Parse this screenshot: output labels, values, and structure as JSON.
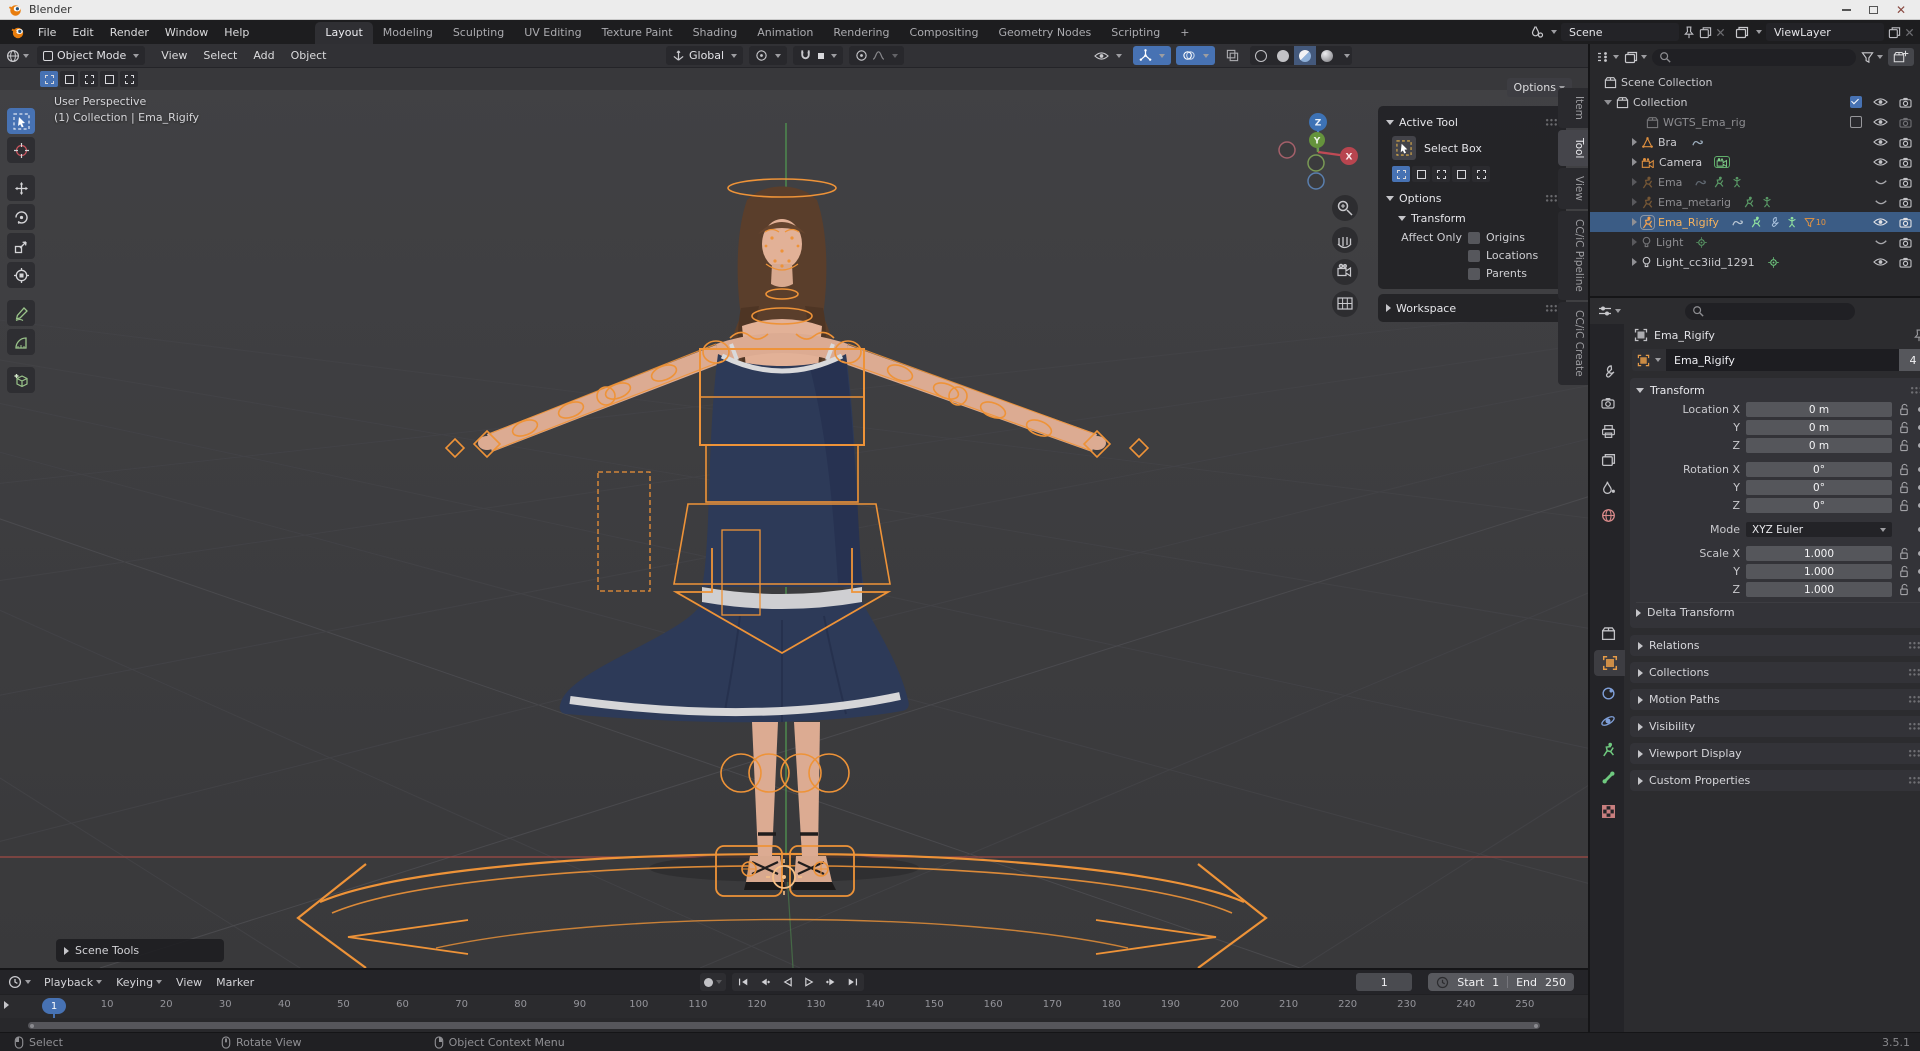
{
  "window": {
    "title": "Blender"
  },
  "topbar": {
    "menus": [
      "File",
      "Edit",
      "Render",
      "Window",
      "Help"
    ],
    "workspaces": [
      "Layout",
      "Modeling",
      "Sculpting",
      "UV Editing",
      "Texture Paint",
      "Shading",
      "Animation",
      "Rendering",
      "Compositing",
      "Geometry Nodes",
      "Scripting"
    ],
    "active_workspace": "Layout",
    "add_tab": "+",
    "scene_label": "Scene",
    "view_layer_label": "ViewLayer"
  },
  "viewport": {
    "header": {
      "mode": "Object Mode",
      "menus": [
        "View",
        "Select",
        "Add",
        "Object"
      ],
      "orientation": "Global"
    },
    "options_button": "Options",
    "overlay_line1": "User Perspective",
    "overlay_line2": "(1) Collection | Ema_Rigify",
    "scene_tools_label": "Scene Tools",
    "axis": {
      "z": "Z",
      "y": "Y",
      "x": "X"
    }
  },
  "tool_panel": {
    "tabs": [
      "Item",
      "Tool",
      "View",
      "CC/iC Pipeline",
      "CC/iC Create"
    ],
    "active_tab": "Tool",
    "active_tool": "Active Tool",
    "tool_name": "Select Box",
    "options": "Options",
    "transform": "Transform",
    "affect_only": "Affect Only",
    "origins": "Origins",
    "locations": "Locations",
    "parents": "Parents",
    "workspace": "Workspace"
  },
  "outliner": {
    "rows": [
      {
        "name": "Scene Collection"
      },
      {
        "name": "Collection"
      },
      {
        "name": "WGTS_Ema_rig"
      },
      {
        "name": "Bra"
      },
      {
        "name": "Camera"
      },
      {
        "name": "Ema"
      },
      {
        "name": "Ema_metarig"
      },
      {
        "name": "Ema_Rigify"
      },
      {
        "name": "Light"
      },
      {
        "name": "Light_cc3iid_1291"
      }
    ],
    "rigify_badge_count": "10"
  },
  "properties": {
    "breadcrumb": "Ema_Rigify",
    "name_value": "Ema_Rigify",
    "users_count": "4",
    "transform": {
      "title": "Transform",
      "rows": [
        {
          "label": "Location X",
          "value": "0 m"
        },
        {
          "label": "Y",
          "value": "0 m"
        },
        {
          "label": "Z",
          "value": "0 m"
        },
        {
          "label": "Rotation X",
          "value": "0°"
        },
        {
          "label": "Y",
          "value": "0°"
        },
        {
          "label": "Z",
          "value": "0°"
        }
      ],
      "mode_label": "Mode",
      "mode_value": "XYZ Euler",
      "scale_rows": [
        {
          "label": "Scale X",
          "value": "1.000"
        },
        {
          "label": "Y",
          "value": "1.000"
        },
        {
          "label": "Z",
          "value": "1.000"
        }
      ],
      "delta_label": "Delta Transform"
    },
    "panels": [
      "Relations",
      "Collections",
      "Motion Paths",
      "Visibility",
      "Viewport Display",
      "Custom Properties"
    ]
  },
  "timeline": {
    "menus": [
      "Playback",
      "Keying",
      "View",
      "Marker"
    ],
    "current_frame": "1",
    "start_label": "Start",
    "start_value": "1",
    "end_label": "End",
    "end_value": "250",
    "ticks": [
      1,
      10,
      20,
      30,
      40,
      50,
      60,
      70,
      80,
      90,
      100,
      110,
      120,
      130,
      140,
      150,
      160,
      170,
      180,
      190,
      200,
      210,
      220,
      230,
      240,
      250
    ]
  },
  "statusbar": {
    "left": "Select",
    "middle": "Rotate View",
    "right_menu": "Object Context Menu",
    "version": "3.5.1"
  }
}
